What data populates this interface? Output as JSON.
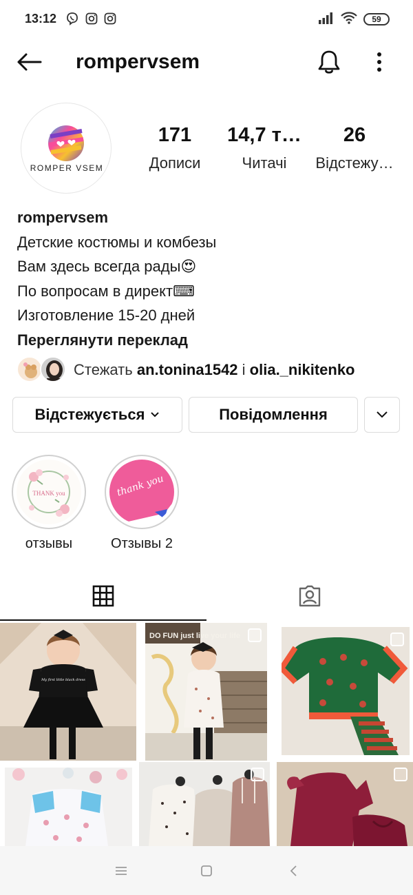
{
  "status_bar": {
    "time": "13:12",
    "left_icons": [
      "viber-icon",
      "instagram-icon",
      "instagram-icon"
    ],
    "right_icons": [
      "signal-icon",
      "wifi-icon"
    ],
    "battery": "59"
  },
  "header": {
    "title": "rompervsem",
    "icons": [
      "back-arrow-icon",
      "bell-icon",
      "more-vertical-icon"
    ]
  },
  "profile": {
    "avatar_text": "ROMPER VSEM",
    "stats": [
      {
        "value": "171",
        "label": "Дописи"
      },
      {
        "value": "14,7 т…",
        "label": "Читачі"
      },
      {
        "value": "26",
        "label": "Відстежу…"
      }
    ],
    "bio": {
      "name": "rompervsem",
      "lines": [
        "Детские костюмы и комбезы",
        "Вам здесь всегда рады😍",
        "По вопросам в директ⌨",
        "Изготовление 15-20 дней"
      ],
      "translate": "Переглянути переклад"
    },
    "followed_by": {
      "prefix": "Стежать ",
      "user1": "an.tonina1542",
      "separator": " і ",
      "user2": "olia._nikitenko"
    }
  },
  "actions": {
    "following_label": "Відстежується",
    "message_label": "Повідомлення"
  },
  "highlights": [
    {
      "label": "отзывы",
      "inner_text": "THANK you"
    },
    {
      "label": "Отзывы 2",
      "inner_text": "thank you"
    }
  ],
  "tabs": [
    "grid-icon",
    "tagged-icon"
  ],
  "grid_posts": [
    {
      "caption": "My first little black dress"
    },
    {
      "caption": "DO FUN just live your life"
    },
    {
      "caption": ""
    },
    {
      "caption": ""
    },
    {
      "caption": ""
    },
    {
      "caption": ""
    }
  ],
  "colors": {
    "text": "#262626",
    "border": "#dbdbdb",
    "highlight_pink": "#ef5c9a",
    "navbar_bg": "#f6f6f6"
  }
}
